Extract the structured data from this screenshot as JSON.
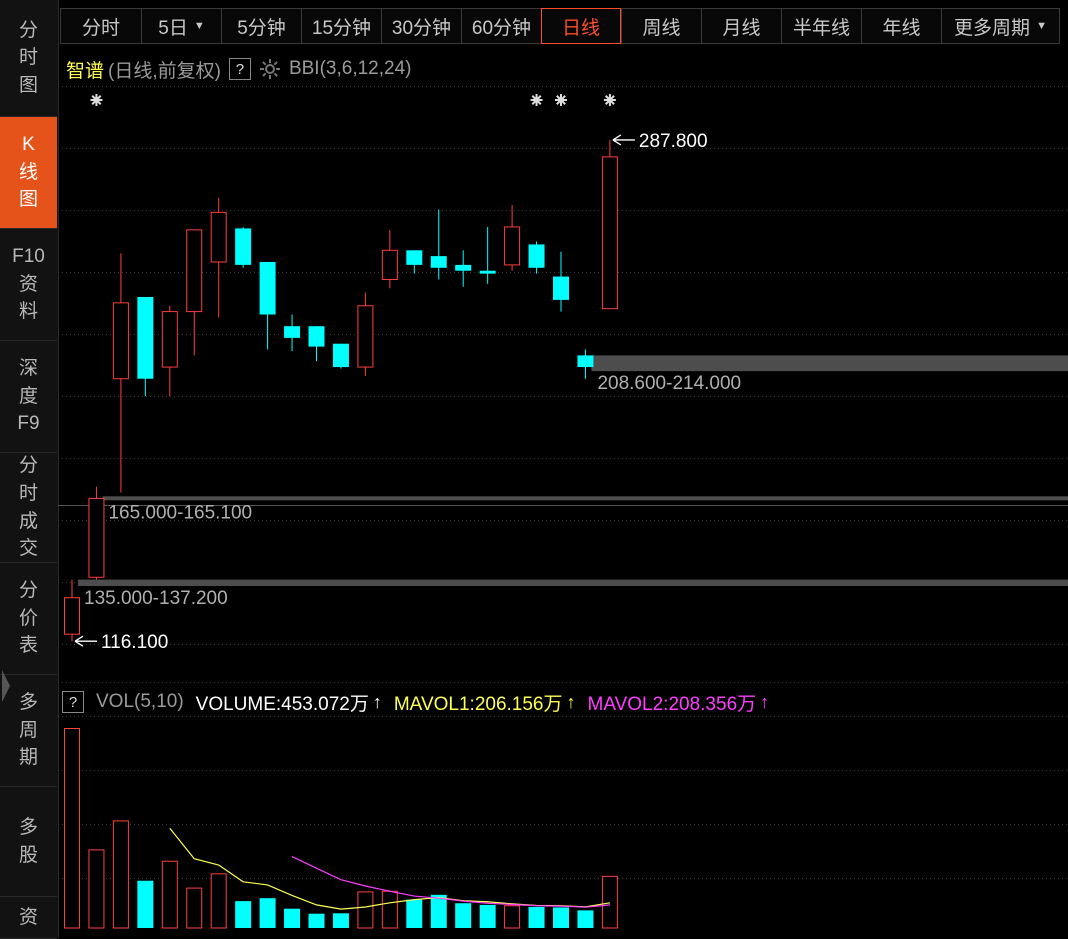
{
  "sidebar": {
    "items": [
      {
        "label": "分时图",
        "chars": [
          "分",
          "时",
          "图"
        ],
        "active": false
      },
      {
        "label": "K线图",
        "chars": [
          "K",
          "线",
          "图"
        ],
        "active": true
      },
      {
        "label": "F10资料",
        "chars": [
          "F10",
          "资",
          "料"
        ],
        "active": false
      },
      {
        "label": "深度F9",
        "chars": [
          "深",
          "度",
          "F9"
        ],
        "active": false
      },
      {
        "label": "分时成交",
        "chars": [
          "分",
          "时",
          "成",
          "交"
        ],
        "active": false
      },
      {
        "label": "分价表",
        "chars": [
          "分",
          "价",
          "表"
        ],
        "active": false
      },
      {
        "label": "多周期",
        "chars": [
          "多",
          "周",
          "期"
        ],
        "active": false
      },
      {
        "label": "多股",
        "chars": [
          "多",
          "股"
        ],
        "active": false
      },
      {
        "label": "资",
        "chars": [
          "资"
        ],
        "active": false
      }
    ]
  },
  "period_tabs": [
    {
      "label": "分时",
      "caret": false,
      "active": false
    },
    {
      "label": "5日",
      "caret": true,
      "active": false
    },
    {
      "label": "5分钟",
      "caret": false,
      "active": false
    },
    {
      "label": "15分钟",
      "caret": false,
      "active": false
    },
    {
      "label": "30分钟",
      "caret": false,
      "active": false
    },
    {
      "label": "60分钟",
      "caret": false,
      "active": false
    },
    {
      "label": "日线",
      "caret": false,
      "active": true
    },
    {
      "label": "周线",
      "caret": false,
      "active": false
    },
    {
      "label": "月线",
      "caret": false,
      "active": false
    },
    {
      "label": "半年线",
      "caret": false,
      "active": false
    },
    {
      "label": "年线",
      "caret": false,
      "active": false
    },
    {
      "label": "更多周期",
      "caret": true,
      "active": false
    }
  ],
  "chart_header": {
    "stock_name": "智谱",
    "adjust_mode": "(日线,前复权)",
    "help": "?",
    "gear_icon": "gear-icon",
    "indicator": "BBI(3,6,12,24)"
  },
  "price_chart": {
    "price_axis": {
      "min": 110,
      "max": 296
    },
    "candles": [
      {
        "o": 118.5,
        "h": 137.2,
        "l": 116.1,
        "c": 131.0
      },
      {
        "o": 138.0,
        "h": 169.0,
        "l": 137.2,
        "c": 165.0
      },
      {
        "o": 206.0,
        "h": 249.0,
        "l": 167.0,
        "c": 232.0
      },
      {
        "o": 234.0,
        "h": 234.0,
        "l": 200.0,
        "c": 206.0
      },
      {
        "o": 210.0,
        "h": 231.0,
        "l": 200.0,
        "c": 229.0
      },
      {
        "o": 229.0,
        "h": 255.0,
        "l": 214.0,
        "c": 257.0
      },
      {
        "o": 246.0,
        "h": 268.0,
        "l": 227.0,
        "c": 263.0
      },
      {
        "o": 257.5,
        "h": 258.0,
        "l": 244.0,
        "c": 245.0
      },
      {
        "o": 246.0,
        "h": 246.0,
        "l": 216.0,
        "c": 228.0
      },
      {
        "o": 224.0,
        "h": 228.0,
        "l": 215.5,
        "c": 220.0
      },
      {
        "o": 224.0,
        "h": 224.0,
        "l": 212.0,
        "c": 217.0
      },
      {
        "o": 218.0,
        "h": 218.0,
        "l": 209.5,
        "c": 210.0
      },
      {
        "o": 210.0,
        "h": 235.5,
        "l": 207.0,
        "c": 231.0
      },
      {
        "o": 240.0,
        "h": 257.0,
        "l": 237.0,
        "c": 250.0
      },
      {
        "o": 250.0,
        "h": 250.0,
        "l": 242.0,
        "c": 245.0
      },
      {
        "o": 248.0,
        "h": 264.0,
        "l": 240.0,
        "c": 244.0
      },
      {
        "o": 245.0,
        "h": 250.0,
        "l": 237.5,
        "c": 243.0
      },
      {
        "o": 243.0,
        "h": 258.0,
        "l": 238.5,
        "c": 242.0
      },
      {
        "o": 245.0,
        "h": 265.5,
        "l": 243.0,
        "c": 258.0
      },
      {
        "o": 252.0,
        "h": 253.0,
        "l": 242.0,
        "c": 244.0
      },
      {
        "o": 241.0,
        "h": 249.5,
        "l": 229.0,
        "c": 233.0
      },
      {
        "o": 214.0,
        "h": 216.0,
        "l": 206.0,
        "c": 210.0
      },
      {
        "o": 230.0,
        "h": 287.8,
        "l": 230.0,
        "c": 282.0
      }
    ],
    "star_bars": [
      1,
      19,
      20,
      22
    ],
    "gap_bands": [
      {
        "range": [
          135.0,
          137.2
        ],
        "label": "135.000-137.200",
        "from_bar": 0
      },
      {
        "range": [
          165.0,
          165.1
        ],
        "label": "165.000-165.100",
        "from_bar": 1
      },
      {
        "range": [
          208.6,
          214.0
        ],
        "label": "208.600-214.000",
        "from_bar": 21
      }
    ],
    "high_marker": {
      "value": 287.8,
      "label": "287.800",
      "bar": 22
    },
    "low_marker": {
      "value": 116.1,
      "label": "116.100",
      "bar": 0
    }
  },
  "volume_header": {
    "help": "?",
    "indicator": "VOL(5,10)",
    "volume": "VOLUME:453.072万",
    "mavol1": "MAVOL1:206.156万",
    "mavol2": "MAVOL2:208.356万",
    "arrow": "↑"
  },
  "volume_chart": {
    "max": 1000,
    "bars": [
      950,
      372,
      510,
      225,
      318,
      190,
      258,
      128,
      142,
      92,
      68,
      70,
      172,
      175,
      135,
      158,
      118,
      110,
      106,
      100,
      98,
      84,
      246
    ],
    "mavol1": [
      null,
      null,
      null,
      null,
      475,
      330,
      300,
      220,
      205,
      155,
      110,
      90,
      100,
      120,
      135,
      145,
      130,
      125,
      115,
      107,
      106,
      101,
      120
    ],
    "mavol2": [
      null,
      null,
      null,
      null,
      null,
      null,
      null,
      null,
      null,
      340,
      285,
      230,
      200,
      175,
      152,
      142,
      128,
      118,
      112,
      106,
      104,
      99,
      110
    ],
    "colors": {
      "up": "#ff4040",
      "down": "#00ffff",
      "mavol1": "#ffff55",
      "mavol2": "#ff3dff"
    }
  },
  "colors": {
    "up": "#ff3d3d",
    "down": "#00ffff",
    "accent": "#e5531a",
    "active_tab": "#ff4d2a",
    "band": "#5a5a5a",
    "grid": "#3a3a3a"
  }
}
